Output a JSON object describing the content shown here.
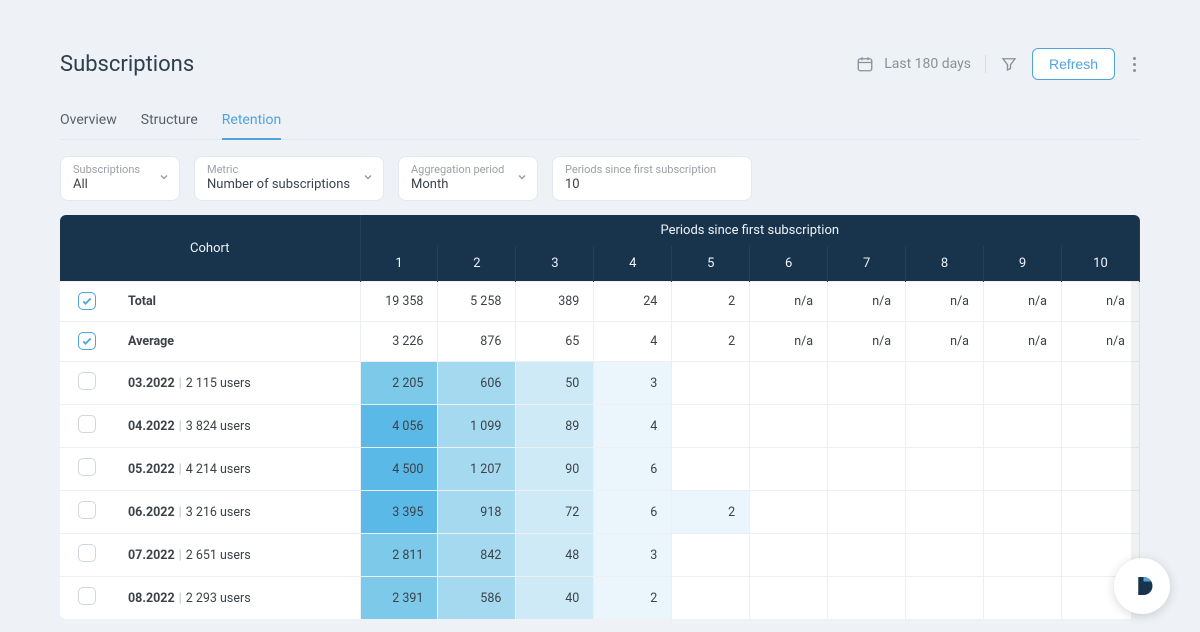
{
  "header": {
    "title": "Subscriptions",
    "date_range": "Last 180 days",
    "refresh": "Refresh"
  },
  "tabs": [
    {
      "label": "Overview",
      "active": false
    },
    {
      "label": "Structure",
      "active": false
    },
    {
      "label": "Retention",
      "active": true
    }
  ],
  "filters": {
    "subscriptions": {
      "label": "Subscriptions",
      "value": "All"
    },
    "metric": {
      "label": "Metric",
      "value": "Number of subscriptions"
    },
    "aggregation": {
      "label": "Aggregation period",
      "value": "Month"
    },
    "periods": {
      "label": "Periods since first subscription",
      "value": "10"
    }
  },
  "table": {
    "cohort_header": "Cohort",
    "periods_header": "Periods since first subscription",
    "period_numbers": [
      "1",
      "2",
      "3",
      "4",
      "5",
      "6",
      "7",
      "8",
      "9",
      "10"
    ],
    "rows": [
      {
        "checked": true,
        "label": "Total",
        "users": "",
        "values": [
          "19 358",
          "5 258",
          "389",
          "24",
          "2",
          "n/a",
          "n/a",
          "n/a",
          "n/a",
          "n/a"
        ],
        "heat": [
          "",
          "",
          "",
          "",
          "",
          "",
          "",
          "",
          "",
          ""
        ]
      },
      {
        "checked": true,
        "label": "Average",
        "users": "",
        "values": [
          "3 226",
          "876",
          "65",
          "4",
          "2",
          "n/a",
          "n/a",
          "n/a",
          "n/a",
          "n/a"
        ],
        "heat": [
          "",
          "",
          "",
          "",
          "",
          "",
          "",
          "",
          "",
          ""
        ]
      },
      {
        "checked": false,
        "label": "03.2022",
        "users": "2 115 users",
        "values": [
          "2 205",
          "606",
          "50",
          "3",
          "",
          "",
          "",
          "",
          "",
          ""
        ],
        "heat": [
          "h3",
          "h2",
          "h1",
          "h0",
          "",
          "",
          "",
          "",
          "",
          ""
        ]
      },
      {
        "checked": false,
        "label": "04.2022",
        "users": "3 824 users",
        "values": [
          "4 056",
          "1 099",
          "89",
          "4",
          "",
          "",
          "",
          "",
          "",
          ""
        ],
        "heat": [
          "h4",
          "h2",
          "h1",
          "h0",
          "",
          "",
          "",
          "",
          "",
          ""
        ]
      },
      {
        "checked": false,
        "label": "05.2022",
        "users": "4 214 users",
        "values": [
          "4 500",
          "1 207",
          "90",
          "6",
          "",
          "",
          "",
          "",
          "",
          ""
        ],
        "heat": [
          "h4",
          "h2",
          "h1",
          "h0",
          "",
          "",
          "",
          "",
          "",
          ""
        ]
      },
      {
        "checked": false,
        "label": "06.2022",
        "users": "3 216 users",
        "values": [
          "3 395",
          "918",
          "72",
          "6",
          "2",
          "",
          "",
          "",
          "",
          ""
        ],
        "heat": [
          "h4",
          "h2",
          "h1",
          "h0",
          "h0",
          "",
          "",
          "",
          "",
          ""
        ]
      },
      {
        "checked": false,
        "label": "07.2022",
        "users": "2 651 users",
        "values": [
          "2 811",
          "842",
          "48",
          "3",
          "",
          "",
          "",
          "",
          "",
          ""
        ],
        "heat": [
          "h3",
          "h2",
          "h1",
          "h0",
          "",
          "",
          "",
          "",
          "",
          ""
        ]
      },
      {
        "checked": false,
        "label": "08.2022",
        "users": "2 293 users",
        "values": [
          "2 391",
          "586",
          "40",
          "2",
          "",
          "",
          "",
          "",
          "",
          ""
        ],
        "heat": [
          "h3",
          "h2",
          "h1",
          "h0",
          "",
          "",
          "",
          "",
          "",
          ""
        ]
      }
    ]
  },
  "heat_colors": {
    "h4": "#5ab9e6",
    "h3": "#7cc9ea",
    "h2": "#a5d9f0",
    "h1": "#cfeaf7",
    "h0": "#eaf6fc",
    "": ""
  }
}
